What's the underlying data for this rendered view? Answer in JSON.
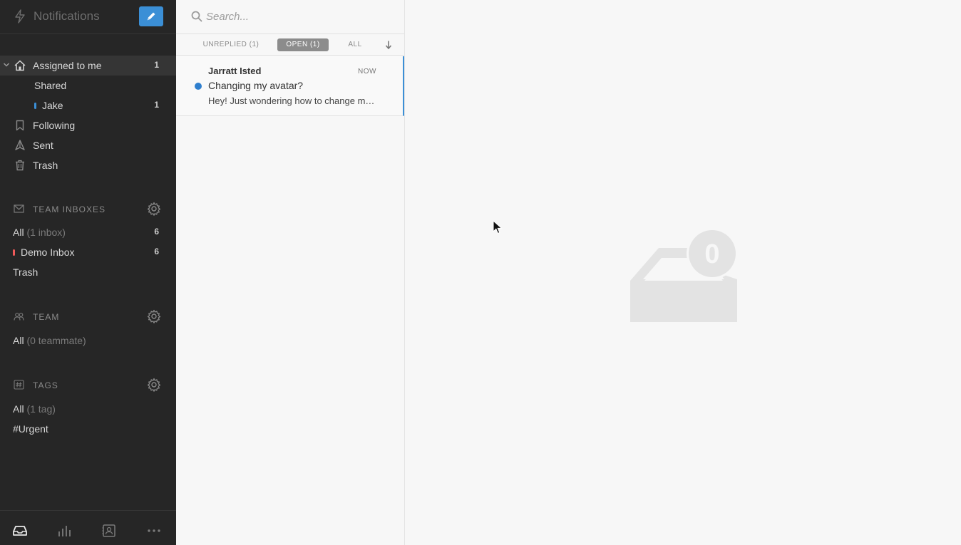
{
  "sidebar": {
    "header_title": "Notifications",
    "nav": [
      {
        "label": "Assigned to me",
        "count": "1"
      },
      {
        "label": "Shared",
        "count": ""
      },
      {
        "label": "Jake",
        "count": "1"
      },
      {
        "label": "Following",
        "count": ""
      },
      {
        "label": "Sent",
        "count": ""
      },
      {
        "label": "Trash",
        "count": ""
      }
    ],
    "team_inboxes": {
      "title": "TEAM INBOXES",
      "all_label": "All",
      "all_suffix": "(1 inbox)",
      "all_count": "6",
      "demo_label": "Demo Inbox",
      "demo_count": "6",
      "trash_label": "Trash"
    },
    "team": {
      "title": "TEAM",
      "all_label": "All",
      "all_suffix": "(0 teammate)"
    },
    "tags": {
      "title": "TAGS",
      "all_label": "All",
      "all_suffix": "(1 tag)",
      "urgent_label": "#Urgent"
    }
  },
  "list": {
    "search_placeholder": "Search...",
    "tabs": [
      {
        "label": "UNREPLIED (1)"
      },
      {
        "label": "OPEN (1)"
      },
      {
        "label": "ALL"
      }
    ],
    "conversation": {
      "from": "Jarratt Isted",
      "time": "NOW",
      "subject": "Changing my avatar?",
      "preview": "Hey! Just wondering how to change my avatar?"
    }
  },
  "main": {
    "empty_count": "0"
  },
  "colors": {
    "accent": "#3b8fd6",
    "sidebar_bg": "#262626",
    "jake_dot": "#3b8fd6",
    "demo_inbox_dot": "#ef5a5a"
  }
}
